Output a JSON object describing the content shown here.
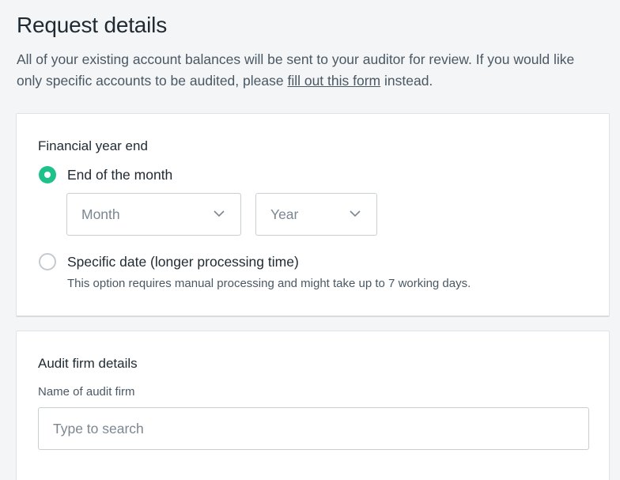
{
  "page": {
    "title": "Request details",
    "intro_before": "All of your existing account balances will be sent to your auditor for review. If you would like only specific accounts to be audited, please ",
    "intro_link": "fill out this form",
    "intro_after": " instead."
  },
  "financial_year_end": {
    "heading": "Financial year end",
    "options": [
      {
        "label": "End of the month",
        "checked": true
      },
      {
        "label": "Specific date (longer processing time)",
        "checked": false,
        "help": "This option requires manual processing and might take up to 7 working days."
      }
    ],
    "month_select": {
      "placeholder": "Month"
    },
    "year_select": {
      "placeholder": "Year"
    }
  },
  "audit_firm": {
    "heading": "Audit firm details",
    "name_label": "Name of audit firm",
    "name_placeholder": "Type to search"
  },
  "colors": {
    "accent": "#1fc18a",
    "text": "#1f2a33",
    "muted": "#4a5863",
    "background": "#f4f5f7"
  },
  "icons": {
    "select_chevron": "chevron-down-icon"
  }
}
